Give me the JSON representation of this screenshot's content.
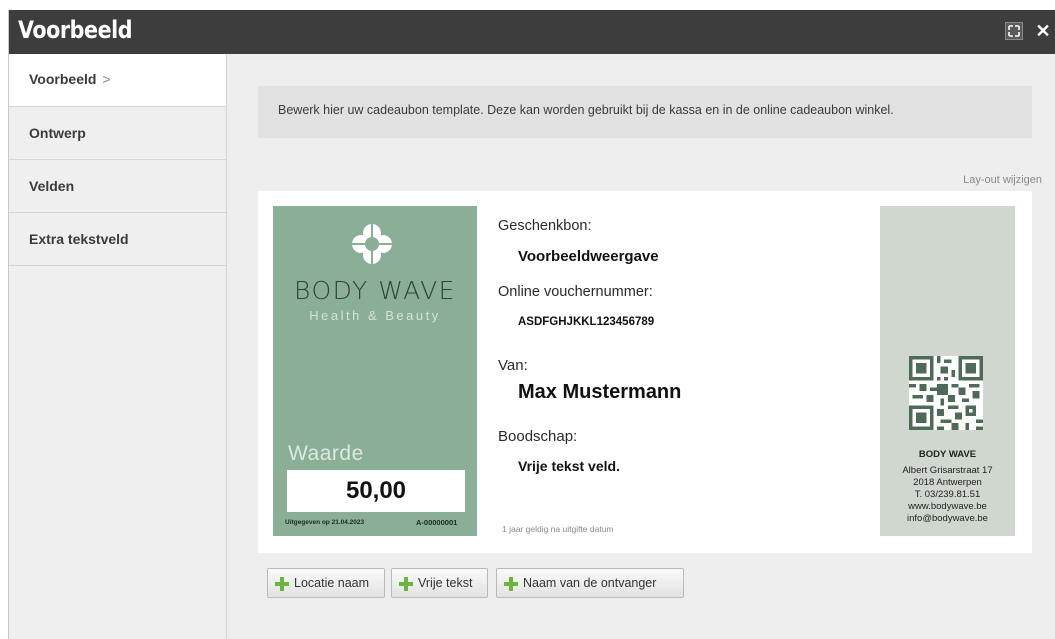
{
  "window": {
    "title": "Voorbeeld",
    "expand_label": "⛶",
    "close_label": "✕"
  },
  "sidebar": {
    "items": [
      {
        "label": "Voorbeeld",
        "chevron": ">"
      },
      {
        "label": "Ontwerp"
      },
      {
        "label": "Velden"
      },
      {
        "label": "Extra tekstveld"
      }
    ]
  },
  "main": {
    "info_text": "Bewerk hier uw cadeaubon template. Deze kan worden gebruikt bij de kassa en in de online cadeaubon winkel.",
    "layout_link": "Lay-out wijzigen"
  },
  "voucher": {
    "brand": "BODY WAVE",
    "brand_sub": "Health & Beauty",
    "waarde_label": "Waarde",
    "value": "50,00",
    "issued": "Uitgegeven op 21.04.2023",
    "code": "A-00000001",
    "gift_label": "Geschenkbon:",
    "gift_value": "Voorbeeldweergave",
    "online_label": "Online vouchernummer:",
    "online_value": "ASDFGHJKKL123456789",
    "from_label": "Van:",
    "from_value": "Max Mustermann",
    "message_label": "Boodschap:",
    "message_value": "Vrije tekst veld.",
    "validity": "1 jaar geldig na uitgifte datum",
    "company": "BODY WAVE",
    "address": "Albert Grisarstraat 17",
    "city": "2018 Antwerpen",
    "phone": "T. 03/239.81.51",
    "website": "www.bodywave.be",
    "email": "info@bodywave.be"
  },
  "buttons": {
    "location": "Locatie naam",
    "free_text": "Vrije tekst",
    "recipient": "Naam van de ontvanger"
  },
  "colors": {
    "titlebar": "#3d3d3d",
    "voucher_green": "#8aae96",
    "voucher_panel": "#cfd7cf",
    "plus_icon": "#6db33f"
  }
}
